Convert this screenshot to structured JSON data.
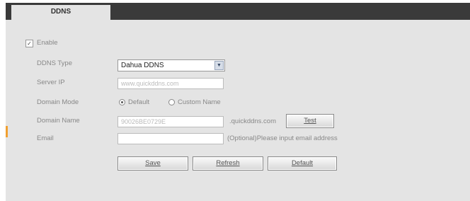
{
  "tab": {
    "label": "DDNS"
  },
  "form": {
    "enable": {
      "label": "Enable",
      "checked": true
    },
    "ddns_type": {
      "label": "DDNS Type",
      "value": "Dahua DDNS"
    },
    "server_ip": {
      "label": "Server IP",
      "value": "www.quickddns.com"
    },
    "domain_mode": {
      "label": "Domain Mode",
      "options": [
        "Default",
        "Custom Name"
      ],
      "selected": "Default"
    },
    "domain_name": {
      "label": "Domain Name",
      "value": "90026BE0729E",
      "suffix": ".quickddns.com",
      "test_label": "Test"
    },
    "email": {
      "label": "Email",
      "value": "",
      "hint": "(Optional)Please input email address"
    }
  },
  "buttons": {
    "save": "Save",
    "refresh": "Refresh",
    "default": "Default"
  },
  "colors": {
    "tabbar": "#3a3a3a",
    "panel": "#e4e4e4",
    "accent": "#f0a030"
  }
}
